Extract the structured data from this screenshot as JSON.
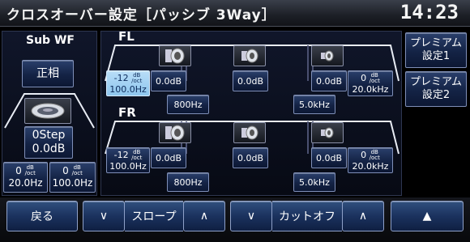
{
  "header": {
    "title": "クロスオーバー設定［パッシブ 3Way］",
    "clock": "14:23"
  },
  "subwf": {
    "label": "Sub WF",
    "phase": "正相",
    "step": "0Step",
    "level": "0.0dB",
    "hpf": {
      "slope": "0",
      "freq": "20.0Hz"
    },
    "lpf": {
      "slope": "0",
      "freq": "100.0Hz"
    }
  },
  "fl": {
    "label": "FL",
    "low_slope": "-12",
    "low_freq": "100.0Hz",
    "woofer_level": "0.0dB",
    "mid_level": "0.0dB",
    "tweeter_level": "0.0dB",
    "high_slope": "0",
    "high_freq": "20.0kHz",
    "crossover1": "800Hz",
    "crossover2": "5.0kHz"
  },
  "fr": {
    "label": "FR",
    "low_slope": "-12",
    "low_freq": "100.0Hz",
    "woofer_level": "0.0dB",
    "mid_level": "0.0dB",
    "tweeter_level": "0.0dB",
    "high_slope": "0",
    "high_freq": "20.0kHz",
    "crossover1": "800Hz",
    "crossover2": "5.0kHz"
  },
  "units": {
    "db": "dB",
    "oct": "/oct"
  },
  "presets": {
    "p1_line1": "プレミアム",
    "p1_line2": "設定1",
    "p2_line1": "プレミアム",
    "p2_line2": "設定2"
  },
  "bottom": {
    "back": "戻る",
    "slope": "スロープ",
    "cutoff": "カットオフ",
    "down": "∨",
    "up": "∧",
    "eject": "▲"
  },
  "colors": {
    "highlight": "#9fd0f2",
    "accent": "#1b325e"
  }
}
